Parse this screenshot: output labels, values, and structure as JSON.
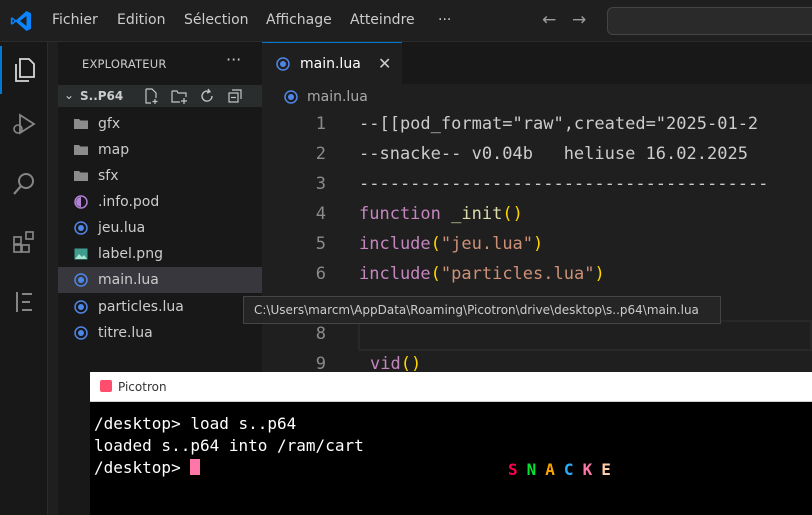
{
  "titlebar": {
    "menu": [
      "Fichier",
      "Edition",
      "Sélection",
      "Affichage",
      "Atteindre",
      "···"
    ],
    "nav_back": "←",
    "nav_forward": "→"
  },
  "sidebar": {
    "title": "EXPLORATEUR",
    "more": "···",
    "folder": {
      "chevron": "⌄",
      "name": "S..P64"
    },
    "items": [
      {
        "label": "gfx",
        "icon": "folder"
      },
      {
        "label": "map",
        "icon": "folder"
      },
      {
        "label": "sfx",
        "icon": "folder"
      },
      {
        "label": ".info.pod",
        "icon": "pod"
      },
      {
        "label": "jeu.lua",
        "icon": "lua"
      },
      {
        "label": "label.png",
        "icon": "image"
      },
      {
        "label": "main.lua",
        "icon": "lua"
      },
      {
        "label": "particles.lua",
        "icon": "lua"
      },
      {
        "label": "titre.lua",
        "icon": "lua"
      }
    ]
  },
  "editor": {
    "tab": {
      "label": "main.lua",
      "close": "✕"
    },
    "breadcrumb": "main.lua",
    "line_numbers": [
      "1",
      "2",
      "3",
      "4",
      "5",
      "6",
      "8",
      "9"
    ],
    "lines": {
      "l1": "--[[pod_format=\"raw\",created=\"2025-01-2",
      "l2": "--snacke-- v0.04b   heliuse 16.02.2025",
      "l3": "----------------------------------------",
      "l4_kw": "function",
      "l4_fn": "_init",
      "l4_par": "()",
      "l5_kw": "include",
      "l5_open": "(",
      "l5_str": "\"jeu.lua\"",
      "l5_close": ")",
      "l6_kw": "include",
      "l6_open": "(",
      "l6_str": "\"particles.lua\"",
      "l6_close": ")",
      "l9_kw": "vid",
      "l9_par": "()"
    }
  },
  "tooltip": "C:\\Users\\marcm\\AppData\\Roaming\\Picotron\\drive\\desktop\\s..p64\\main.lua",
  "picotron": {
    "title": "Picotron",
    "terminal": [
      "/desktop> load s..p64",
      "loaded s..p64 into /ram/cart",
      "/desktop> "
    ],
    "snacke_letters": [
      {
        "ch": "S",
        "color": "#ff004d"
      },
      {
        "ch": "N",
        "color": "#00e436"
      },
      {
        "ch": "A",
        "color": "#ffa300"
      },
      {
        "ch": "C",
        "color": "#29adff"
      },
      {
        "ch": "K",
        "color": "#ff77a8"
      },
      {
        "ch": "E",
        "color": "#ffccaa"
      }
    ]
  },
  "colors": {
    "accent": "#0078d4",
    "keyword": "#c586c0",
    "string": "#ce9178",
    "function": "#dcdcaa",
    "bracket": "#ffd700",
    "cursor": "#ff77a8"
  }
}
